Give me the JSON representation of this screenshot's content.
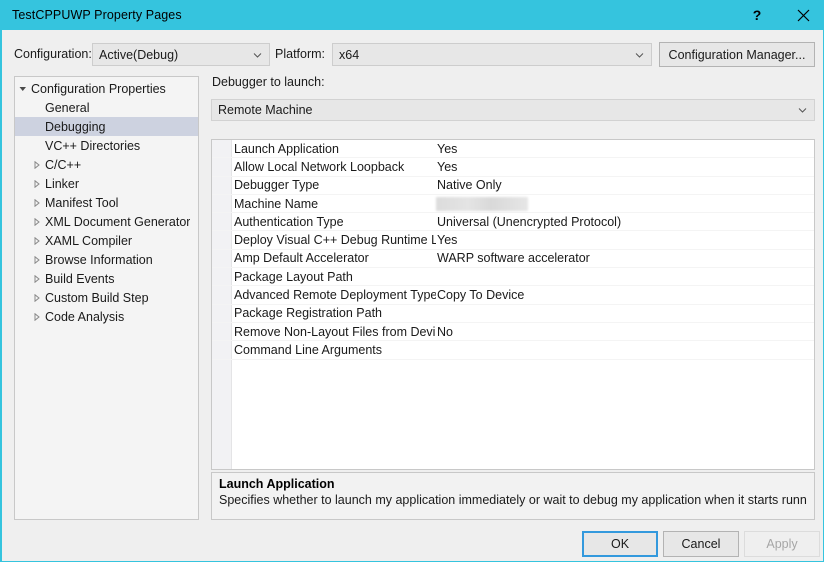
{
  "window": {
    "title": "TestCPPUWP Property Pages",
    "accent_color": "#35c4de",
    "help_glyph": "?",
    "close_glyph": "close-icon"
  },
  "toolbar": {
    "configuration_label": "Configuration:",
    "configuration_value": "Active(Debug)",
    "platform_label": "Platform:",
    "platform_value": "x64",
    "configuration_manager_label": "Configuration Manager..."
  },
  "sidebar": {
    "items": [
      {
        "label": "Configuration Properties",
        "indent": 0,
        "twisty": "expanded",
        "selected": false
      },
      {
        "label": "General",
        "indent": 1,
        "twisty": "none",
        "selected": false
      },
      {
        "label": "Debugging",
        "indent": 1,
        "twisty": "none",
        "selected": true
      },
      {
        "label": "VC++ Directories",
        "indent": 1,
        "twisty": "none",
        "selected": false
      },
      {
        "label": "C/C++",
        "indent": 1,
        "twisty": "collapsed",
        "selected": false
      },
      {
        "label": "Linker",
        "indent": 1,
        "twisty": "collapsed",
        "selected": false
      },
      {
        "label": "Manifest Tool",
        "indent": 1,
        "twisty": "collapsed",
        "selected": false
      },
      {
        "label": "XML Document Generator",
        "indent": 1,
        "twisty": "collapsed",
        "selected": false
      },
      {
        "label": "XAML Compiler",
        "indent": 1,
        "twisty": "collapsed",
        "selected": false
      },
      {
        "label": "Browse Information",
        "indent": 1,
        "twisty": "collapsed",
        "selected": false
      },
      {
        "label": "Build Events",
        "indent": 1,
        "twisty": "collapsed",
        "selected": false
      },
      {
        "label": "Custom Build Step",
        "indent": 1,
        "twisty": "collapsed",
        "selected": false
      },
      {
        "label": "Code Analysis",
        "indent": 1,
        "twisty": "collapsed",
        "selected": false
      }
    ]
  },
  "main": {
    "debugger_label": "Debugger to launch:",
    "debugger_value": "Remote Machine",
    "properties": [
      {
        "name": "Launch Application",
        "value": "Yes",
        "redacted": false
      },
      {
        "name": "Allow Local Network Loopback",
        "value": "Yes",
        "redacted": false
      },
      {
        "name": "Debugger Type",
        "value": "Native Only",
        "redacted": false
      },
      {
        "name": "Machine Name",
        "value": "",
        "redacted": true
      },
      {
        "name": "Authentication Type",
        "value": "Universal (Unencrypted Protocol)",
        "redacted": false
      },
      {
        "name": "Deploy Visual C++ Debug Runtime Li",
        "value": "Yes",
        "redacted": false
      },
      {
        "name": "Amp Default Accelerator",
        "value": "WARP software accelerator",
        "redacted": false
      },
      {
        "name": "Package Layout Path",
        "value": "",
        "redacted": false
      },
      {
        "name": "Advanced Remote Deployment Type",
        "value": "Copy To Device",
        "redacted": false
      },
      {
        "name": "Package Registration Path",
        "value": "",
        "redacted": false
      },
      {
        "name": "Remove Non-Layout Files from Devic",
        "value": "No",
        "redacted": false
      },
      {
        "name": "Command Line Arguments",
        "value": "",
        "redacted": false
      }
    ]
  },
  "description": {
    "title": "Launch Application",
    "body": "Specifies whether to launch my application immediately or wait to debug my application when it starts runnin..."
  },
  "footer": {
    "ok_label": "OK",
    "cancel_label": "Cancel",
    "apply_label": "Apply",
    "apply_enabled": false
  }
}
